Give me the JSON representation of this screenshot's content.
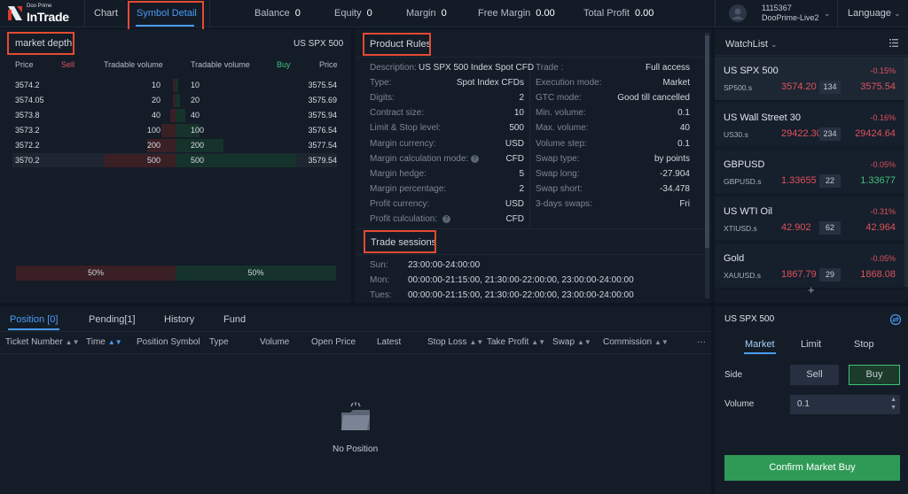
{
  "brand": {
    "tagline": "Doo Prime",
    "name": "InTrade"
  },
  "nav": {
    "chart": "Chart",
    "symbol_detail": "Symbol Detail"
  },
  "stats": [
    {
      "label": "Balance",
      "value": "0"
    },
    {
      "label": "Equity",
      "value": "0"
    },
    {
      "label": "Margin",
      "value": "0"
    },
    {
      "label": "Free Margin",
      "value": "0.00"
    },
    {
      "label": "Total Profit",
      "value": "0.00"
    }
  ],
  "account": {
    "id": "1115367",
    "server": "DooPrime-Live2"
  },
  "language": "Language",
  "market_depth": {
    "title": "market depth",
    "symbol": "US SPX 500",
    "headers": {
      "price": "Price",
      "sell": "Sell",
      "tradable_volume_left": "Tradable volume",
      "tradable_volume_right": "Tradable volume",
      "buy": "Buy",
      "price_right": "Price"
    },
    "rows": [
      {
        "sell_price": "3574.2",
        "sell_vol": "10",
        "buy_vol": "10",
        "buy_price": "3575.54",
        "sell_fill": 0.02,
        "buy_fill": 0.02
      },
      {
        "sell_price": "3574.05",
        "sell_vol": "20",
        "buy_vol": "20",
        "buy_price": "3575.69",
        "sell_fill": 0.04,
        "buy_fill": 0.04
      },
      {
        "sell_price": "3573.8",
        "sell_vol": "40",
        "buy_vol": "40",
        "buy_price": "3575.94",
        "sell_fill": 0.08,
        "buy_fill": 0.08
      },
      {
        "sell_price": "3573.2",
        "sell_vol": "100",
        "buy_vol": "100",
        "buy_price": "3576.54",
        "sell_fill": 0.2,
        "buy_fill": 0.2
      },
      {
        "sell_price": "3572.2",
        "sell_vol": "200",
        "buy_vol": "200",
        "buy_price": "3577.54",
        "sell_fill": 0.4,
        "buy_fill": 0.4
      },
      {
        "sell_price": "3570.2",
        "sell_vol": "500",
        "buy_vol": "500",
        "buy_price": "3579.54",
        "sell_fill": 1.0,
        "buy_fill": 1.0
      }
    ],
    "sell_pct": "50%",
    "buy_pct": "50%"
  },
  "product_rules": {
    "title": "Product Rules",
    "left": [
      {
        "label": "Description:",
        "value": "US SPX 500 Index Spot CFD"
      },
      {
        "label": "Type:",
        "value": "Spot Index CFDs"
      },
      {
        "label": "Digits:",
        "value": "2"
      },
      {
        "label": "Contract size:",
        "value": "10"
      },
      {
        "label": "Limit & Stop level:",
        "value": "500"
      },
      {
        "label": "Margin currency:",
        "value": "USD"
      },
      {
        "label": "Margin calculation mode:",
        "value": "CFD"
      },
      {
        "label": "Margin hedge:",
        "value": "5"
      },
      {
        "label": "Margin percentage:",
        "value": "2"
      },
      {
        "label": "Profit currency:",
        "value": "USD"
      },
      {
        "label": "Profit culculation:",
        "value": "CFD"
      }
    ],
    "right": [
      {
        "label": "Trade :",
        "value": "Full access"
      },
      {
        "label": "Execution mode:",
        "value": "Market"
      },
      {
        "label": "GTC mode:",
        "value": "Good till cancelled"
      },
      {
        "label": "Min. volume:",
        "value": "0.1"
      },
      {
        "label": "Max. volume:",
        "value": "40"
      },
      {
        "label": "Volume step:",
        "value": "0.1"
      },
      {
        "label": "Swap type:",
        "value": "by points"
      },
      {
        "label": "Swap long:",
        "value": "-27.904"
      },
      {
        "label": "Swap short:",
        "value": "-34.478"
      },
      {
        "label": "3-days swaps:",
        "value": "Fri"
      }
    ]
  },
  "trade_sessions": {
    "title": "Trade sessions",
    "rows": [
      {
        "day": "Sun:",
        "times": "23:00:00-24:00:00"
      },
      {
        "day": "Mon:",
        "times": "00:00:00-21:15:00, 21:30:00-22:00:00, 23:00:00-24:00:00"
      },
      {
        "day": "Tues:",
        "times": "00:00:00-21:15:00, 21:30:00-22:00:00, 23:00:00-24:00:00"
      }
    ]
  },
  "watchlist": {
    "title": "WatchList",
    "items": [
      {
        "name": "US SPX 500",
        "change": "-0.15%",
        "symbol": "SP500.s",
        "bid": "3574.20",
        "spread": "134",
        "ask": "3575.54",
        "ask_up": false
      },
      {
        "name": "US Wall Street 30",
        "change": "-0.16%",
        "symbol": "US30.s",
        "bid": "29422.30",
        "spread": "234",
        "ask": "29424.64",
        "ask_up": false
      },
      {
        "name": "GBPUSD",
        "change": "-0.05%",
        "symbol": "GBPUSD.s",
        "bid": "1.33655",
        "spread": "22",
        "ask": "1.33677",
        "ask_up": true
      },
      {
        "name": "US WTI Oil",
        "change": "-0.31%",
        "symbol": "XTIUSD.s",
        "bid": "42.902",
        "spread": "62",
        "ask": "42.964",
        "ask_up": false
      },
      {
        "name": "Gold",
        "change": "-0.05%",
        "symbol": "XAUUSD.s",
        "bid": "1867.79",
        "spread": "29",
        "ask": "1868.08",
        "ask_up": false
      }
    ],
    "add": "+"
  },
  "positions": {
    "tabs": [
      "Position [0]",
      "Pending[1]",
      "History",
      "Fund"
    ],
    "columns": [
      "Ticket Number",
      "Time",
      "Position Symbol",
      "Type",
      "Volume",
      "Open Price",
      "Latest",
      "Stop Loss",
      "Take Profit",
      "Swap",
      "Commission"
    ],
    "more": "···",
    "empty": "No Position"
  },
  "order": {
    "symbol": "US SPX 500",
    "tabs": [
      "Market",
      "Limit",
      "Stop"
    ],
    "side_label": "Side",
    "sell": "Sell",
    "buy": "Buy",
    "volume_label": "Volume",
    "volume_value": "0.1",
    "confirm": "Confirm Market Buy"
  }
}
